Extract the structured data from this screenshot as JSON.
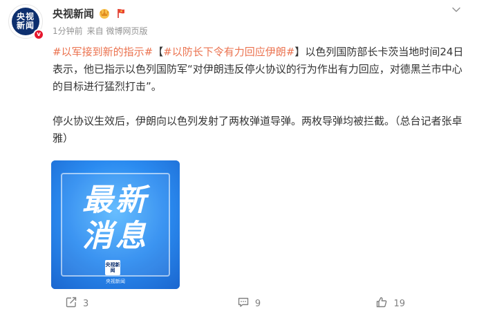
{
  "post": {
    "author": {
      "name": "央视新闻",
      "avatar_text": [
        "央视",
        "新闻"
      ],
      "verified_mark": "v",
      "icons": [
        "crown-badge-icon",
        "red-flag-badge-icon"
      ]
    },
    "meta": {
      "time": "1分钟前",
      "source": "来自 微博网页版"
    },
    "content": {
      "topic1": "#以军接到新的指示#",
      "bracket_open": "【",
      "topic2": "#以防长下令有力回应伊朗#",
      "bracket_close": "】",
      "text1": "以色列国防部长卡茨当地时间24日表示，他已指示以色列国防军“对伊朗违反停火协议的行为作出有力回应，对德黑兰市中心的目标进行猛烈打击”。",
      "text2": "停火协议生效后，伊朗向以色列发射了两枚弹道导弹。两枚导弹均被拦截。（总台记者张卓雅）"
    },
    "image": {
      "title_line1": "最新",
      "title_line2": "消息",
      "logo_text": "央视新闻",
      "caption": "央视新闻"
    },
    "actions": {
      "repost_count": "3",
      "comment_count": "9",
      "like_count": "19"
    }
  },
  "colors": {
    "topic": "#eb7350",
    "text": "#333333",
    "meta": "#939393",
    "image_blue": "#2b8bf0",
    "verified_red": "#e6162d"
  }
}
